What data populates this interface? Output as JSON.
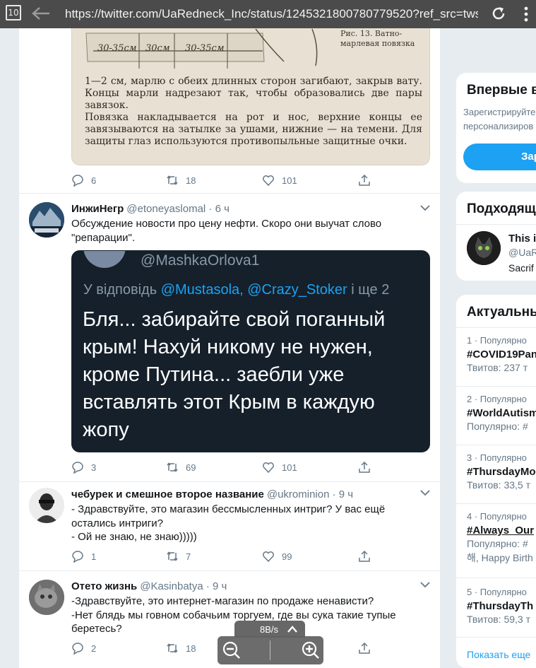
{
  "browser": {
    "tab_count": "10",
    "url": "https://twitter.com/UaRedneck_Inc/status/1245321800780779520?ref_src=tws..."
  },
  "tweets": [
    {
      "image_text": {
        "labels": [
          "30-35см",
          "30см",
          "30-35см"
        ],
        "caption": "Рис. 13. Ватно-марлевая повязка",
        "body": "1—2 см, марлю с обеих длинных сторон загибают, закрыв вату. Концы марли надрезают так, чтобы образовались две пары завязок.\nПовязка накладывается на рот и нос, верхние концы ее завязываются на затылке за ушами, нижние — на темени. Для защиты глаз используются противопыльные защитные очки."
      },
      "replies": "6",
      "retweets": "18",
      "likes": "101"
    },
    {
      "name": "ИнжиНегр",
      "handle": "@etoneyaslomal",
      "time": "· 6 ч",
      "text": "Обсуждение новости про цену нефти. Скоро они выучат слово \"репарации\".",
      "media": {
        "handle": "@MashkaOrlova1",
        "reply_prefix": "У відповідь",
        "reply_handles": "@Mustasola, @Crazy_Stoker",
        "reply_suffix": "і ще 2",
        "text": "Бля... забирайте свой поганный крым! Нахуй никому не нужен, кроме Путина... заебли уже вставлять этот Крым в каждую жопу"
      },
      "replies": "3",
      "retweets": "69",
      "likes": "101"
    },
    {
      "name": "чебурек и смешное второе название",
      "handle": "@ukrominion",
      "time": "· 9 ч",
      "text": "- Здравствуйте, это магазин бессмысленных интриг? У вас ещё остались интриги?\n- Ой не знаю, не знаю)))))",
      "replies": "1",
      "retweets": "7",
      "likes": "99"
    },
    {
      "name": "Отето жизнь",
      "handle": "@Kasinbatya",
      "time": "· 9 ч",
      "text": "-Здравствуйте, это интернет-магазин по продаже ненависти?\n-Нет блядь мы говном собачьим торгуем, где вы сука такие тупые беретесь?",
      "replies": "2",
      "retweets": "18",
      "likes": ""
    }
  ],
  "sidebar": {
    "signup": {
      "title": "Впервые в",
      "sub1": "Зарегистрируйте",
      "sub2": "персонализиров",
      "button": "Зар"
    },
    "suggest": {
      "title": "Подходящ",
      "name": "This i",
      "handle": "@UaR",
      "bio": "Sacrif"
    },
    "trends": {
      "title": "Актуальны",
      "items": [
        {
          "meta": "1 · Популярно",
          "name": "#COVID19Pan",
          "count": "Твитов: 237 т"
        },
        {
          "meta": "2 · Популярно",
          "name": "#WorldAutism",
          "count": "Популярно: #"
        },
        {
          "meta": "3 · Популярно",
          "name": "#ThursdayMo",
          "count": "Твитов: 33,5 т"
        },
        {
          "meta": "4 · Популярно",
          "name": "#Always_Our",
          "count": "Популярно: #",
          "count2": "해, Happy Birth"
        },
        {
          "meta": "5 · Популярно",
          "name": "#ThursdayTh",
          "count": "Твитов: 59,3 т"
        }
      ],
      "show_more": "Показать еще"
    }
  },
  "overlay": {
    "speed": "8B/s"
  }
}
